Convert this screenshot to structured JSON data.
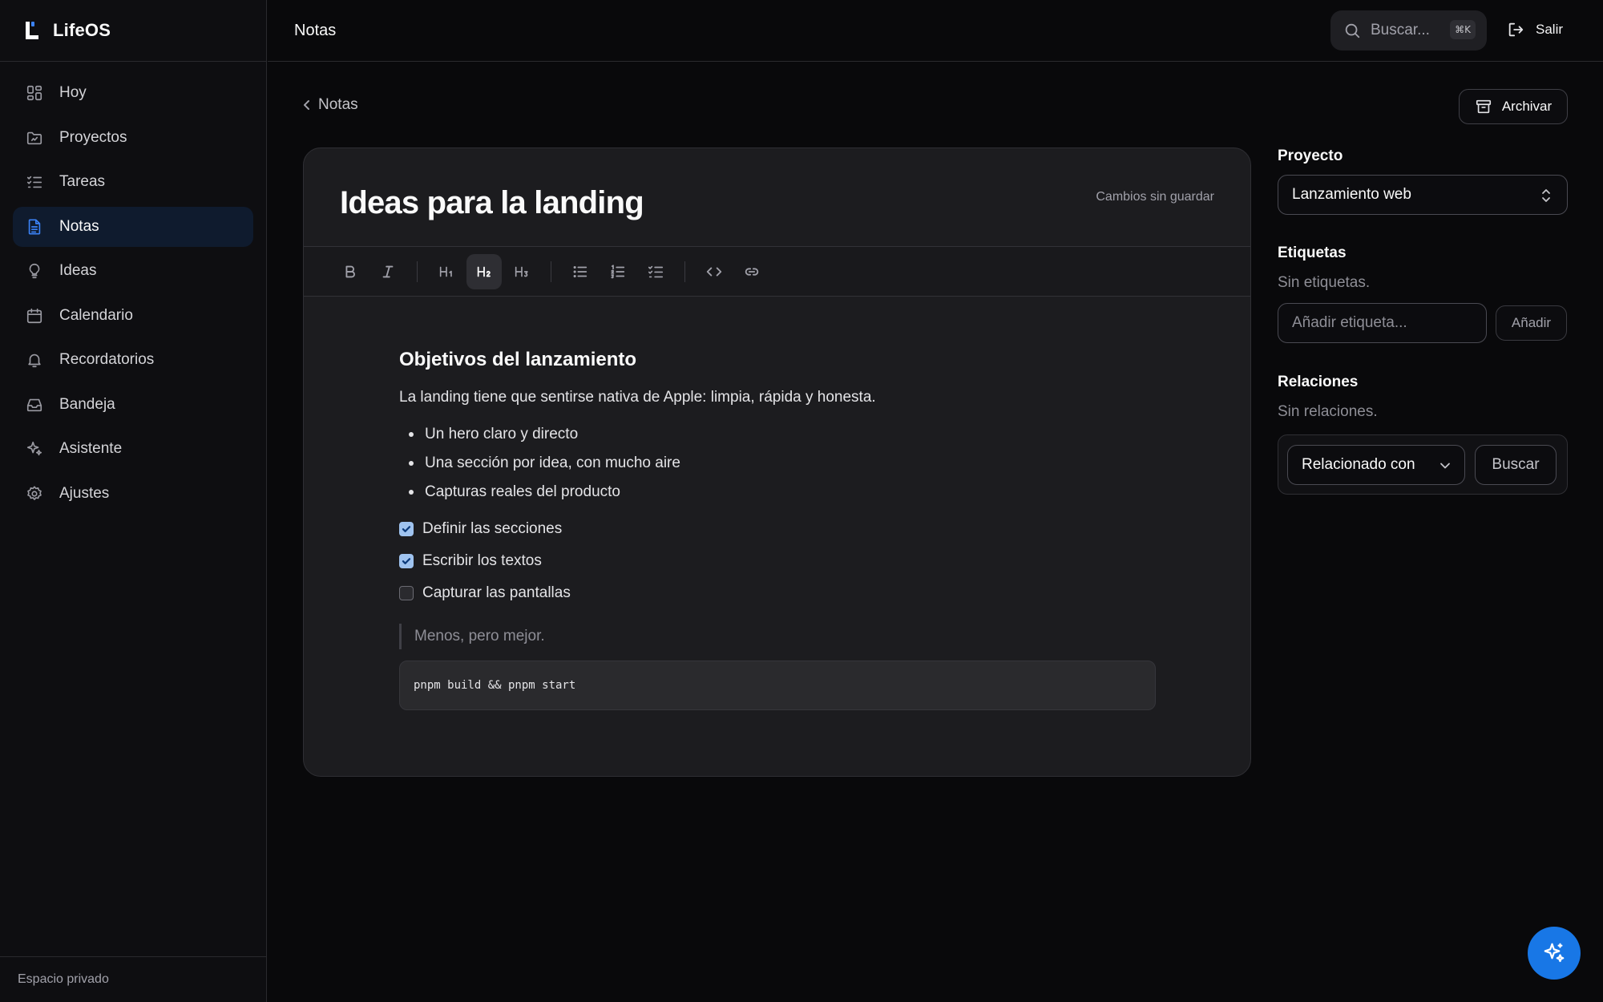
{
  "app": {
    "name": "LifeOS",
    "accent": "#3b82f6",
    "fab_color": "#1877e6"
  },
  "sidebar": {
    "items": [
      {
        "label": "Hoy",
        "icon": "grid-icon"
      },
      {
        "label": "Proyectos",
        "icon": "folder-icon"
      },
      {
        "label": "Tareas",
        "icon": "checklist-icon"
      },
      {
        "label": "Notas",
        "icon": "document-icon",
        "active": true
      },
      {
        "label": "Ideas",
        "icon": "lightbulb-icon"
      },
      {
        "label": "Calendario",
        "icon": "calendar-icon"
      },
      {
        "label": "Recordatorios",
        "icon": "bell-icon"
      },
      {
        "label": "Bandeja",
        "icon": "inbox-icon"
      },
      {
        "label": "Asistente",
        "icon": "sparkles-icon"
      },
      {
        "label": "Ajustes",
        "icon": "gear-icon"
      }
    ],
    "footer": "Espacio privado"
  },
  "topbar": {
    "title": "Notas",
    "search_placeholder": "Buscar...",
    "search_shortcut": "⌘K",
    "logout_label": "Salir"
  },
  "page": {
    "back_label": "Notas",
    "archive_label": "Archivar"
  },
  "editor": {
    "title": "Ideas para la landing",
    "save_status": "Cambios sin guardar",
    "toolbar": [
      "bold",
      "italic",
      "heading-1",
      "heading-2",
      "heading-3",
      "bullet-list",
      "numbered-list",
      "task-list",
      "code",
      "link"
    ],
    "active_tool": "heading-2",
    "heading": "Objetivos del lanzamiento",
    "paragraph": "La landing tiene que sentirse nativa de Apple: limpia, rápida y honesta.",
    "bullets": [
      "Un hero claro y directo",
      "Una sección por idea, con mucho aire",
      "Capturas reales del producto"
    ],
    "tasks": [
      {
        "label": "Definir las secciones",
        "checked": true
      },
      {
        "label": "Escribir los textos",
        "checked": true
      },
      {
        "label": "Capturar las pantallas",
        "checked": false
      }
    ],
    "quote": "Menos, pero mejor.",
    "code": "pnpm build && pnpm start"
  },
  "panel": {
    "project_title": "Proyecto",
    "project_value": "Lanzamiento web",
    "tags_title": "Etiquetas",
    "tags_empty": "Sin etiquetas.",
    "tag_placeholder": "Añadir etiqueta...",
    "add_label": "Añadir",
    "relations_title": "Relaciones",
    "relations_empty": "Sin relaciones.",
    "relation_type": "Relacionado con",
    "relation_search": "Buscar"
  }
}
